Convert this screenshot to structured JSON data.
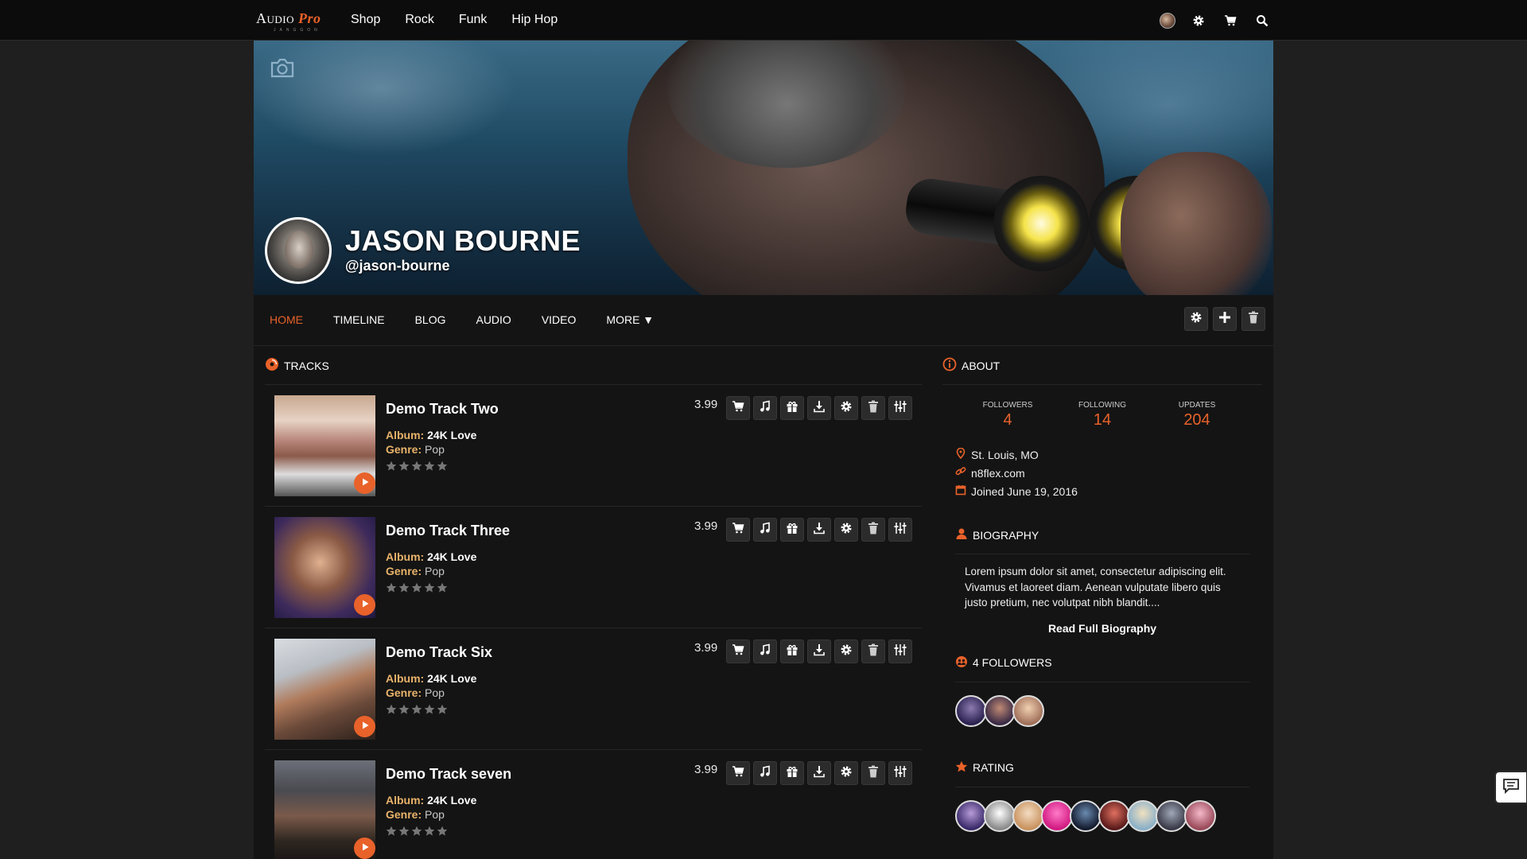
{
  "brand": {
    "name": "Audio",
    "accent": "Pro",
    "sub": "JANGGON",
    "accent_color": "#e8622a"
  },
  "top_nav": [
    "Shop",
    "Rock",
    "Funk",
    "Hip Hop"
  ],
  "profile": {
    "name": "JASON BOURNE",
    "handle": "@jason-bourne"
  },
  "tabs": [
    "HOME",
    "TIMELINE",
    "BLOG",
    "AUDIO",
    "VIDEO",
    "MORE ▼"
  ],
  "tracks_section": {
    "title": "TRACKS"
  },
  "tracks": [
    {
      "title": "Demo Track Two",
      "album_label": "Album:",
      "album": "24K Love",
      "genre_label": "Genre:",
      "genre": "Pop",
      "price": "3.99"
    },
    {
      "title": "Demo Track Three",
      "album_label": "Album:",
      "album": "24K Love",
      "genre_label": "Genre:",
      "genre": "Pop",
      "price": "3.99"
    },
    {
      "title": "Demo Track Six",
      "album_label": "Album:",
      "album": "24K Love",
      "genre_label": "Genre:",
      "genre": "Pop",
      "price": "3.99"
    },
    {
      "title": "Demo Track seven",
      "album_label": "Album:",
      "album": "24K Love",
      "genre_label": "Genre:",
      "genre": "Pop",
      "price": "3.99"
    }
  ],
  "about": {
    "title": "ABOUT",
    "stats": [
      {
        "label": "FOLLOWERS",
        "value": "4"
      },
      {
        "label": "FOLLOWING",
        "value": "14"
      },
      {
        "label": "UPDATES",
        "value": "204"
      }
    ],
    "location": "St. Louis, MO",
    "website": "n8flex.com",
    "joined": "Joined June 19, 2016"
  },
  "biography": {
    "title": "BIOGRAPHY",
    "text": "Lorem ipsum dolor sit amet, consectetur adipiscing elit. Vivamus et laoreet diam. Aenean vulputate libero quis justo pretium, nec volutpat nibh blandit....",
    "link": "Read Full Biography"
  },
  "followers": {
    "title": "4 FOLLOWERS"
  },
  "rating": {
    "title": "RATING"
  }
}
